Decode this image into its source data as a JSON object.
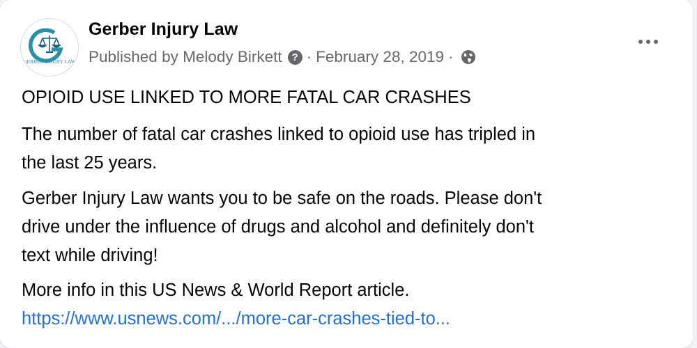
{
  "post": {
    "author": "Gerber Injury Law",
    "meta": {
      "published_by": "Published by Melody Birkett",
      "help_icon_glyph": "?",
      "separator": "·",
      "date": "February 28, 2019",
      "privacy_icon": "globe-icon"
    },
    "avatar": {
      "logo_letters": "G",
      "logo_ring_text": "GERBER INJURY LAW",
      "icon": "scales-of-justice-icon"
    },
    "more_icon": "more-horizontal-icon",
    "title": "OPIOID USE LINKED TO MORE FATAL CAR CRASHES",
    "paragraph1": [
      "The number of fatal car crashes linked to opioid use has tripled in",
      "the last 25 years."
    ],
    "paragraph2": [
      "Gerber Injury Law wants you to be safe on the roads. Please don't",
      "drive under the influence of drugs and alcohol and definitely don't",
      "text while driving!"
    ],
    "paragraph3": {
      "text": "More info in this US News & World Report article.",
      "link": "https://www.usnews.com/.../more-car-crashes-tied-to..."
    }
  },
  "colors": {
    "text_primary": "#050505",
    "text_secondary": "#65676b",
    "link": "#216fdb",
    "logo_teal": "#2a8fa8",
    "logo_navy": "#1f5e7a"
  }
}
